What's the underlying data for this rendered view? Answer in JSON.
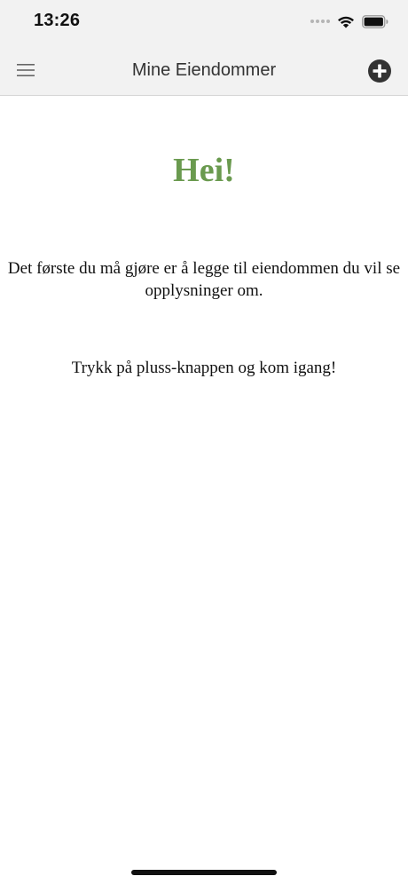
{
  "status_bar": {
    "time": "13:26",
    "icons": [
      "signal-icon",
      "wifi-icon",
      "battery-icon"
    ]
  },
  "nav": {
    "title": "Mine Eiendommer",
    "menu_icon": "hamburger-menu-icon",
    "add_icon": "plus-circle-icon"
  },
  "content": {
    "greeting": "Hei!",
    "intro": "Det første du må gjøre er å legge til eiendommen du vil se opplysninger om.",
    "cta": "Trykk på pluss-knappen og kom igang!"
  },
  "colors": {
    "greeting": "#6a9a4f",
    "header_background": "#f2f2f2",
    "text": "#111111"
  }
}
